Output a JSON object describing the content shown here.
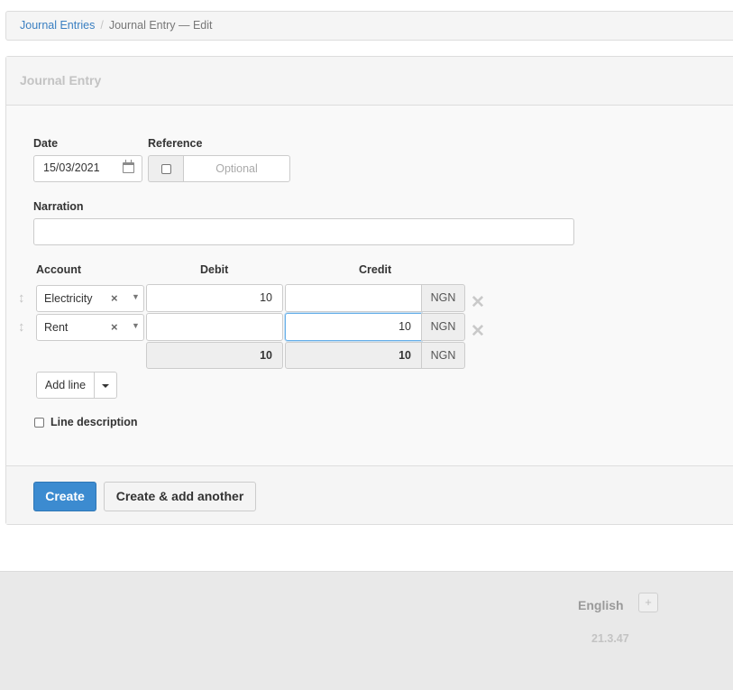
{
  "breadcrumb": {
    "root": "Journal Entries",
    "separator": "/",
    "current": "Journal Entry — Edit"
  },
  "panel": {
    "title": "Journal Entry"
  },
  "form": {
    "date_label": "Date",
    "date_value": "15/03/2021",
    "reference_label": "Reference",
    "reference_placeholder": "Optional",
    "reference_checked": false,
    "narration_label": "Narration",
    "narration_value": ""
  },
  "table": {
    "headers": {
      "account": "Account",
      "debit": "Debit",
      "credit": "Credit"
    },
    "currency": "NGN",
    "rows": [
      {
        "account": "Electricity",
        "debit": "10",
        "credit": ""
      },
      {
        "account": "Rent",
        "debit": "",
        "credit": "10"
      }
    ],
    "totals": {
      "debit": "10",
      "credit": "10"
    },
    "clear_glyph": "×",
    "dropdown_glyph": "▼",
    "remove_glyph": "✕",
    "drag_glyph": "↕"
  },
  "actions": {
    "add_line": "Add line",
    "line_description": "Line description",
    "line_description_checked": false,
    "create": "Create",
    "create_another": "Create & add another"
  },
  "footer": {
    "language": "English",
    "add_glyph": "+",
    "version": "21.3.47"
  },
  "colors": {
    "primary": "#3c8bd0",
    "link": "#3a7fc1",
    "focus_border": "#66afe9"
  }
}
